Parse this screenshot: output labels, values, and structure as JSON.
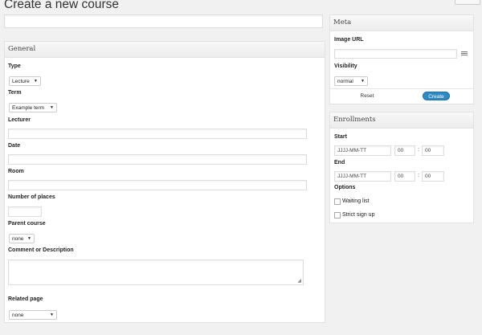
{
  "page": {
    "title": "Create a new course"
  },
  "general": {
    "heading": "General",
    "type": {
      "label": "Type",
      "value": "Lecture"
    },
    "term": {
      "label": "Term",
      "value": "Example term"
    },
    "lecturer": {
      "label": "Lecturer",
      "value": ""
    },
    "date": {
      "label": "Date",
      "value": ""
    },
    "room": {
      "label": "Room",
      "value": ""
    },
    "places": {
      "label": "Number of places",
      "value": ""
    },
    "parent": {
      "label": "Parent course",
      "value": "none"
    },
    "comment": {
      "label": "Comment or Description",
      "value": ""
    },
    "related": {
      "label": "Related page",
      "value": "none"
    }
  },
  "meta": {
    "heading": "Meta",
    "image_url": {
      "label": "Image URL",
      "value": ""
    },
    "visibility": {
      "label": "Visibility",
      "value": "normal"
    },
    "reset_label": "Reset",
    "create_label": "Create"
  },
  "enrollments": {
    "heading": "Enrollments",
    "start": {
      "label": "Start",
      "date": "JJJJ-MM-TT",
      "hour": "00",
      "minute": "00"
    },
    "end": {
      "label": "End",
      "date": "JJJJ-MM-TT",
      "hour": "00",
      "minute": "00"
    },
    "options_label": "Options",
    "waiting_list": "Waiting list",
    "strict_signup": "Strict sign up"
  }
}
